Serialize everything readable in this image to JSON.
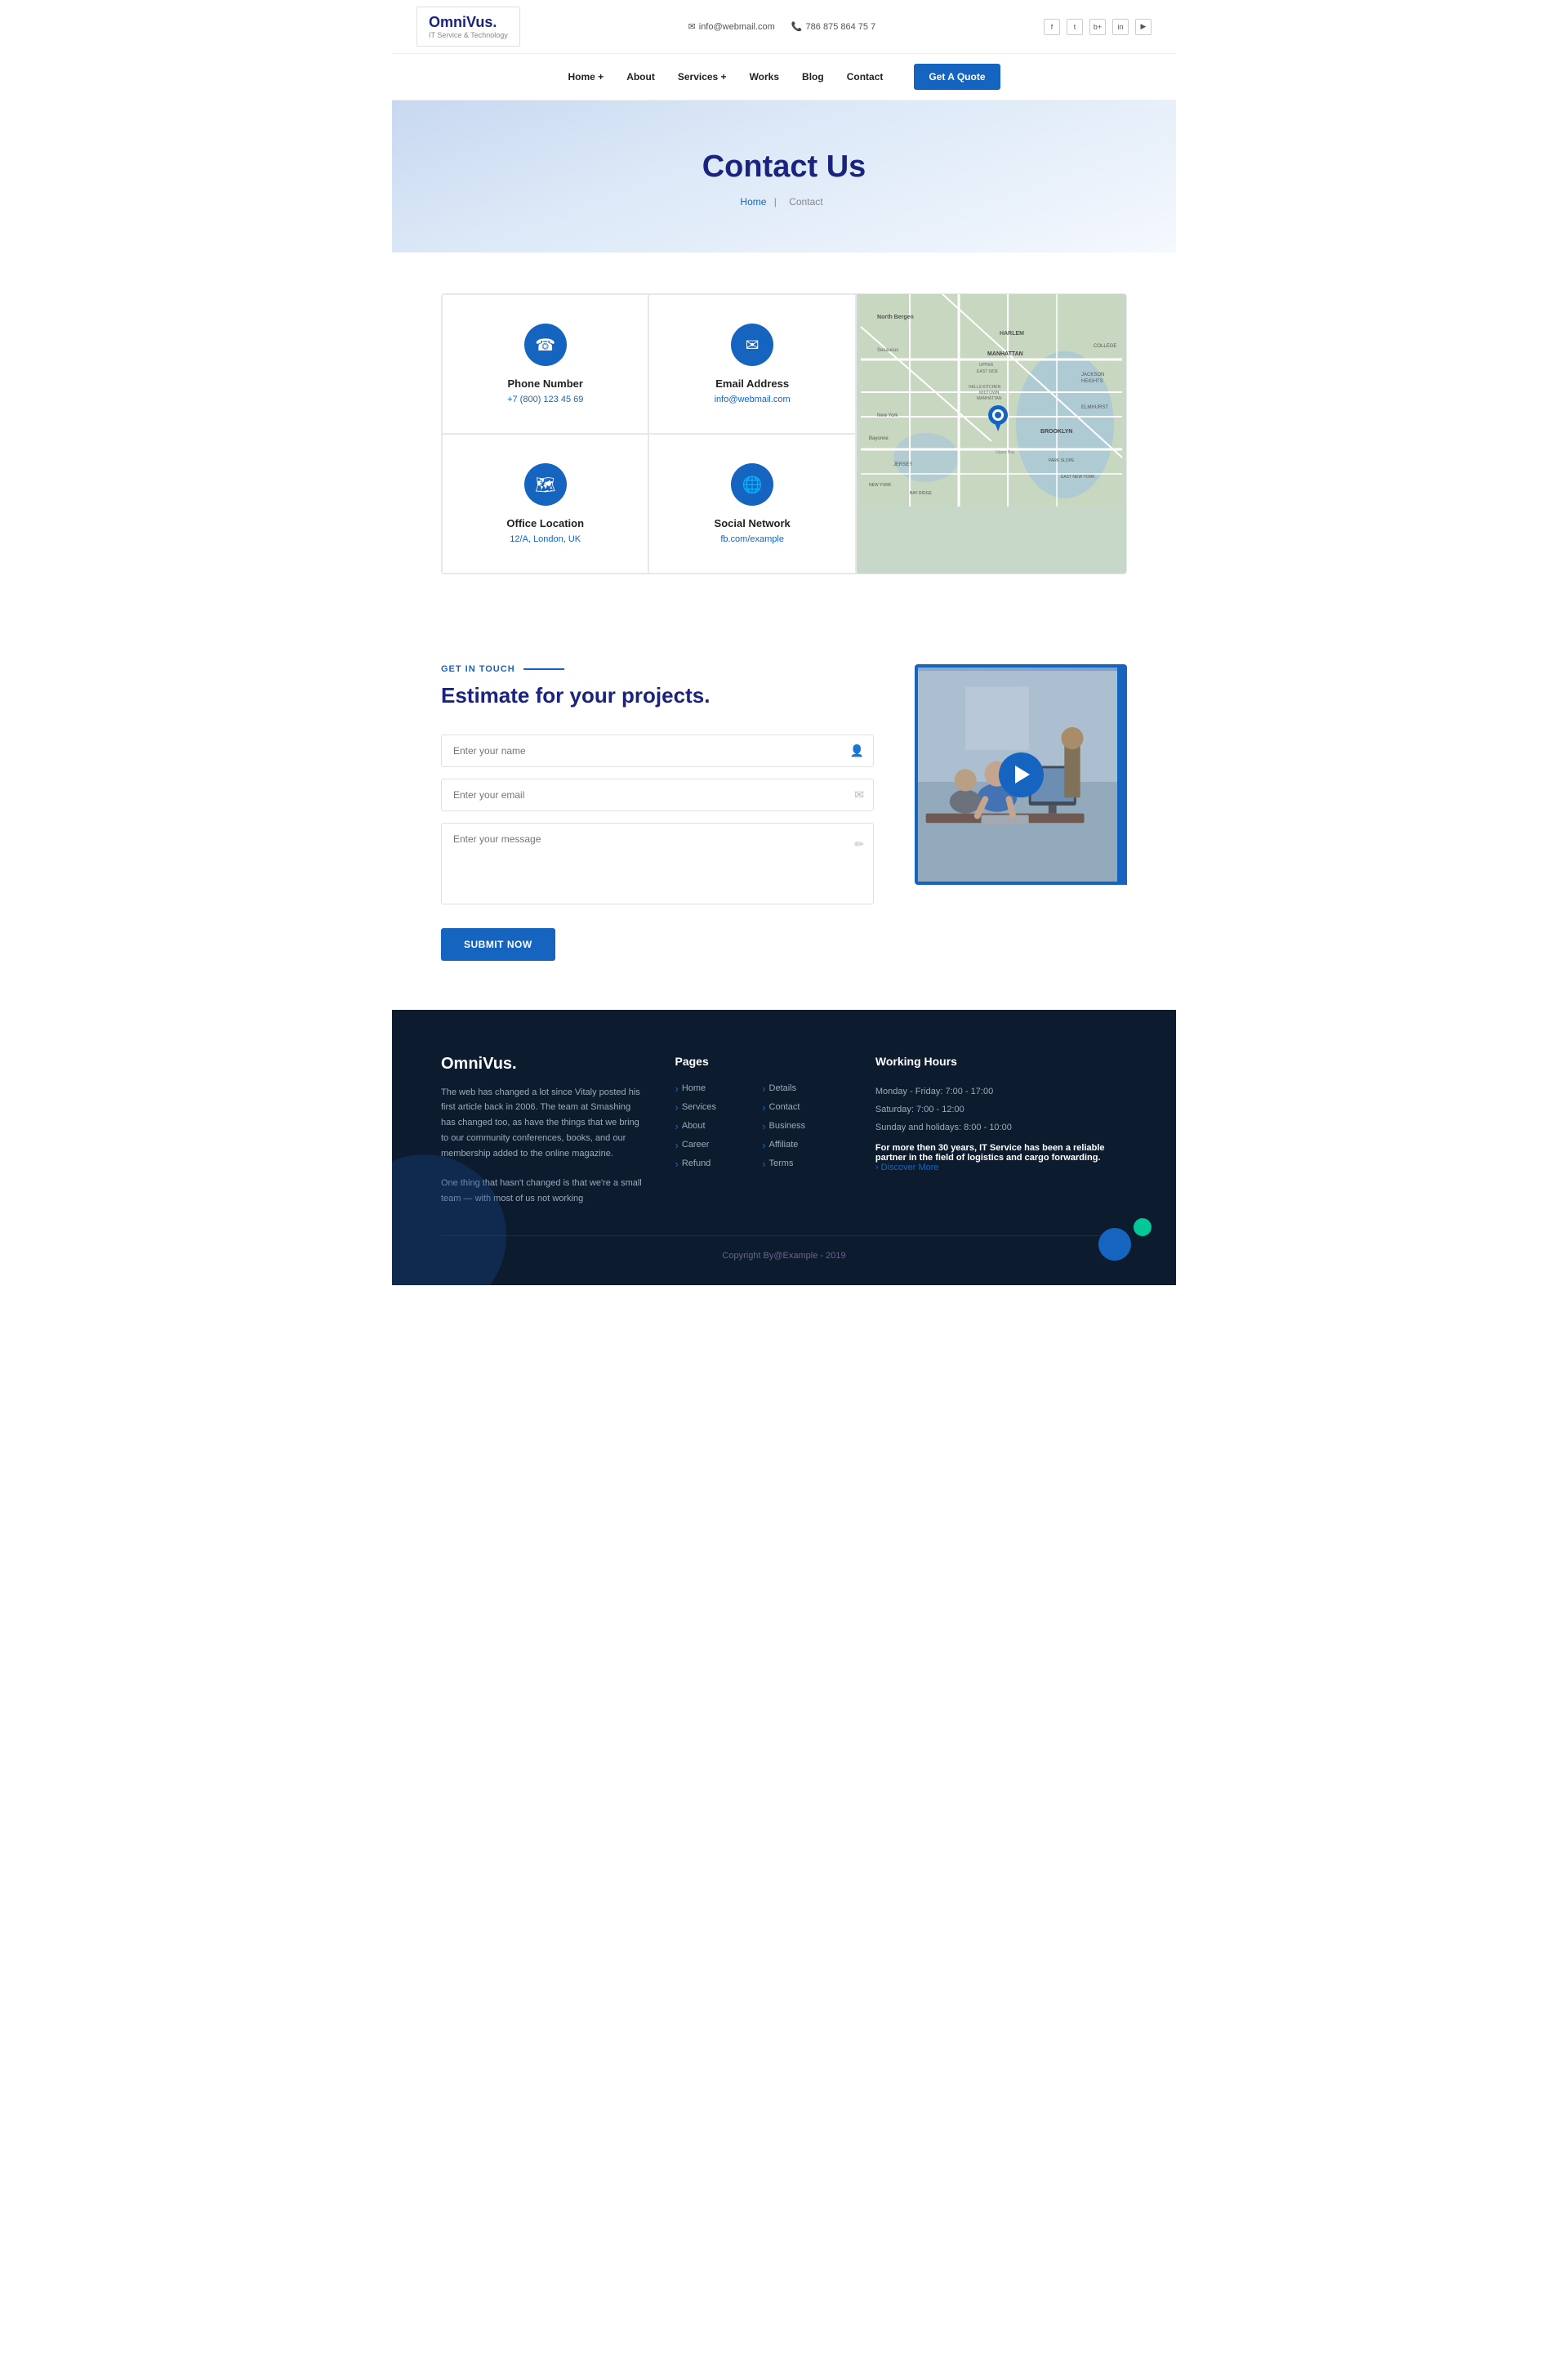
{
  "header": {
    "logo_text": "OmniVus.",
    "logo_sub": "IT Service & Technology",
    "email": "info@webmail.com",
    "phone": "786 875 864 75 7",
    "nav": [
      {
        "label": "Home +",
        "key": "home"
      },
      {
        "label": "About",
        "key": "about"
      },
      {
        "label": "Services +",
        "key": "services"
      },
      {
        "label": "Works",
        "key": "works"
      },
      {
        "label": "Blog",
        "key": "blog"
      },
      {
        "label": "Contact",
        "key": "contact"
      }
    ],
    "quote_btn": "Get A Quote",
    "socials": [
      "f",
      "t",
      "b+",
      "in",
      "yt"
    ]
  },
  "hero": {
    "title": "Contact Us",
    "breadcrumb_home": "Home",
    "breadcrumb_current": "Contact"
  },
  "contact_cards": [
    {
      "icon": "☎",
      "title": "Phone Number",
      "value": "+7 (800) 123 45 69"
    },
    {
      "icon": "✉",
      "title": "Email Address",
      "value": "info@webmail.com"
    },
    {
      "icon": "🗺",
      "title": "Office Location",
      "value": "12/A, London, UK"
    },
    {
      "icon": "🌐",
      "title": "Social Network",
      "value": "fb.com/example"
    }
  ],
  "form_section": {
    "tag": "Get In Touch",
    "title": "Estimate for your projects.",
    "fields": {
      "name_placeholder": "Enter your name",
      "email_placeholder": "Enter your email",
      "message_placeholder": "Enter your message"
    },
    "submit_btn": "Submit Now"
  },
  "footer": {
    "logo": "OmniVus.",
    "desc1": "The web has changed a lot since Vitaly posted his first article back in 2006. The team at Smashing has changed too, as have the things that we bring to our community conferences, books, and our membership added to the online magazine.",
    "desc2": "One thing that hasn't changed is that we're a small team — with most of us not working",
    "pages_title": "Pages",
    "pages": [
      {
        "label": "Home"
      },
      {
        "label": "Details"
      },
      {
        "label": "Services"
      },
      {
        "label": "Contact"
      },
      {
        "label": "About"
      },
      {
        "label": "Business"
      },
      {
        "label": "Career"
      },
      {
        "label": "Affiliate"
      },
      {
        "label": "Refund"
      },
      {
        "label": "Terms"
      }
    ],
    "hours_title": "Working Hours",
    "hours": [
      "Monday - Friday: 7:00 - 17:00",
      "Saturday: 7:00 - 12:00",
      "Sunday and holidays: 8:00 - 10:00"
    ],
    "hours_desc_bold": "For more then 30 years,",
    "hours_desc": " IT Service has been a reliable partner in the field of logistics and cargo forwarding.",
    "discover": "› Discover More",
    "copyright": "Copyright By@Example - 2019"
  }
}
